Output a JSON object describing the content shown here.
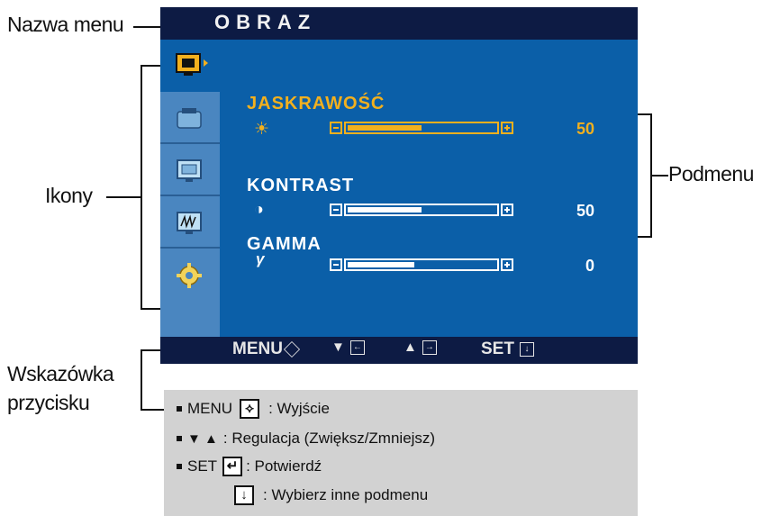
{
  "callouts": {
    "menu_name": "Nazwa menu",
    "icons": "Ikony",
    "submenu": "Podmenu",
    "button_hint_line1": "Wskazówka",
    "button_hint_line2": "przycisku"
  },
  "osd": {
    "title": "OBRAZ",
    "icons": [
      "monitor-picture-icon",
      "picture-settings-icon",
      "screen-position-icon",
      "tracking-icon",
      "gear-icon"
    ],
    "submenu": [
      {
        "label": "JASKRAWOŚĆ",
        "symbol": "☀",
        "value": "50",
        "level": 0.5,
        "color": "#f2b01e"
      },
      {
        "label": "KONTRAST",
        "symbol": "◑",
        "value": "50",
        "level": 0.5,
        "color": "#ffffff"
      },
      {
        "label": "GAMMA",
        "symbol": "γ",
        "value": "0",
        "level": 0.45,
        "color": "#ffffff"
      }
    ],
    "footer": {
      "menu": "MENU",
      "down": "▼",
      "up": "▲",
      "set": "SET"
    },
    "colors": {
      "bg": "#0b5fa8",
      "title_bar": "#0d1b44",
      "highlight": "#f2b01e"
    }
  },
  "hints": {
    "row1": {
      "key": "MENU",
      "text": ": Wyjście"
    },
    "row2": {
      "key": "▼ ▲",
      "text": ": Regulacja (Zwiększ/Zmniejsz)"
    },
    "row3": {
      "key": "SET",
      "text": ": Potwierdź"
    },
    "row4": {
      "text": ": Wybierz inne podmenu"
    }
  }
}
